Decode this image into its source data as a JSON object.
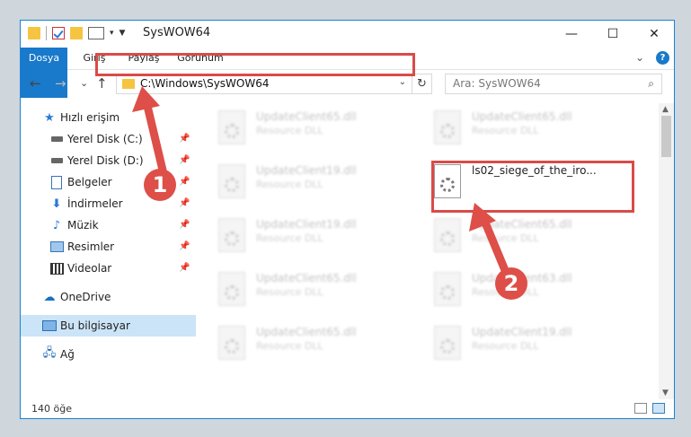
{
  "window": {
    "title": "SysWOW64",
    "controls": [
      "—",
      "☐",
      "✕"
    ]
  },
  "ribbon": {
    "tabs": [
      "Dosya",
      "Giriş",
      "Paylaş",
      "Görünüm"
    ]
  },
  "nav": {
    "back": "←",
    "forward": "→",
    "recent": "⌄",
    "up": "↑",
    "address": "C:\\Windows\\SysWOW64",
    "search_placeholder": "Ara: SysWOW64"
  },
  "sidebar": {
    "quick_access": "Hızlı erişim",
    "items": [
      {
        "label": "Yerel Disk (C:)",
        "icon": "drive-icon",
        "pinned": true
      },
      {
        "label": "Yerel Disk (D:)",
        "icon": "drive-icon",
        "pinned": true
      },
      {
        "label": "Belgeler",
        "icon": "documents-icon",
        "pinned": true
      },
      {
        "label": "İndirmeler",
        "icon": "downloads-icon",
        "pinned": true
      },
      {
        "label": "Müzik",
        "icon": "music-icon",
        "pinned": true
      },
      {
        "label": "Resimler",
        "icon": "pictures-icon",
        "pinned": true
      },
      {
        "label": "Videolar",
        "icon": "videos-icon",
        "pinned": true
      }
    ],
    "onedrive": "OneDrive",
    "this_pc": "Bu bilgisayar",
    "network": "Ağ"
  },
  "files": [
    {
      "name": "UpdateClient65.dll",
      "type": "Resource DLL"
    },
    {
      "name": "UpdateClient65.dll",
      "type": "Resource DLL"
    },
    {
      "name": "UpdateClient19.dll",
      "type": "Resource DLL"
    },
    {
      "name": "ls02_siege_of_the_iro...",
      "type": ""
    },
    {
      "name": "UpdateClient19.dll",
      "type": "Resource DLL"
    },
    {
      "name": "UpdateClient65.dll",
      "type": "Resource DLL"
    },
    {
      "name": "UpdateClient65.dll",
      "type": "Resource DLL"
    },
    {
      "name": "UpdateClient63.dll",
      "type": "Resource DLL"
    },
    {
      "name": "UpdateClient65.dll",
      "type": "Resource DLL"
    },
    {
      "name": "UpdateClient19.dll",
      "type": "Resource DLL"
    }
  ],
  "status": {
    "count": "140 öğe"
  },
  "annotations": {
    "step1": "1",
    "step2": "2",
    "color": "#dd4f48"
  }
}
